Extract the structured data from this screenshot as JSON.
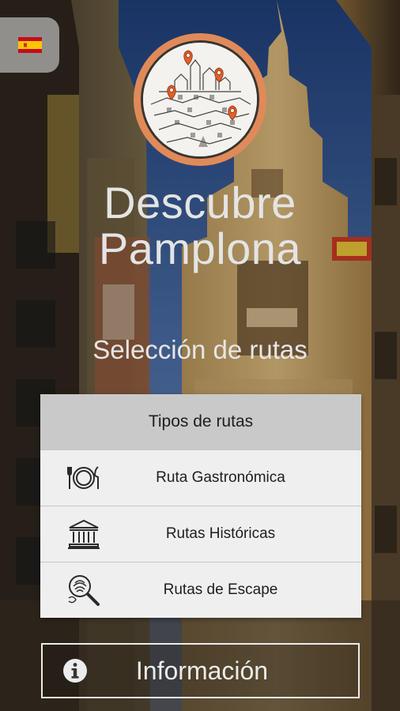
{
  "app": {
    "title": "Descubre Pamplona",
    "subtitle": "Selección de rutas"
  },
  "language": {
    "current": "es",
    "icon": "spain-flag-icon"
  },
  "logo": {
    "icon": "pamplona-skyline-logo"
  },
  "routes": {
    "header": "Tipos de rutas",
    "items": [
      {
        "label": "Ruta Gastronómica",
        "icon": "plate-cutlery-icon"
      },
      {
        "label": "Rutas Históricas",
        "icon": "classical-building-icon"
      },
      {
        "label": "Rutas de Escape",
        "icon": "magnifier-fingerprint-icon"
      }
    ]
  },
  "info": {
    "label": "Información",
    "icon": "info-circle-icon"
  },
  "colors": {
    "accent": "#e0602c",
    "panel_header": "#c9c9c9",
    "panel_item": "#efefef",
    "title_text": "#e4e4e4"
  }
}
